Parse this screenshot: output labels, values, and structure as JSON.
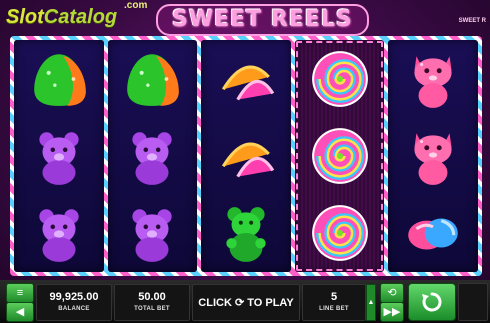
{
  "brand": {
    "slot": "Slot",
    "catalog": "Catalog",
    "com": ".com"
  },
  "game": {
    "title": "SWEET REELS",
    "corner_mark": "SWEET R"
  },
  "reels": [
    [
      "gummy-drop",
      "gummy-bear-purple",
      "gummy-bear-purple"
    ],
    [
      "gummy-drop",
      "gummy-bear-purple",
      "gummy-bear-purple"
    ],
    [
      "fruit-slices",
      "fruit-slices",
      "gummy-bear-green"
    ],
    [
      "lollipop",
      "lollipop",
      "lollipop"
    ],
    [
      "candy-cat",
      "candy-cat",
      "wrapped-candy"
    ]
  ],
  "highlighted_reel": 3,
  "bottom": {
    "balance_value": "99,925.00",
    "balance_label": "BALANCE",
    "total_bet_value": "50.00",
    "total_bet_label": "TOTAL BET",
    "play_label": "CLICK ⟳ TO PLAY",
    "line_bet_value": "5",
    "line_bet_label": "LINE BET",
    "menu_icon": "≡",
    "sound_icon": "◀",
    "auto_icon": "⟲",
    "fast_icon": "▶▶",
    "spin_icon": "⟳"
  },
  "colors": {
    "accent_green": "#3ab54a",
    "title_pink": "#ff9ee0",
    "reel_bg": "#1a0e55"
  }
}
